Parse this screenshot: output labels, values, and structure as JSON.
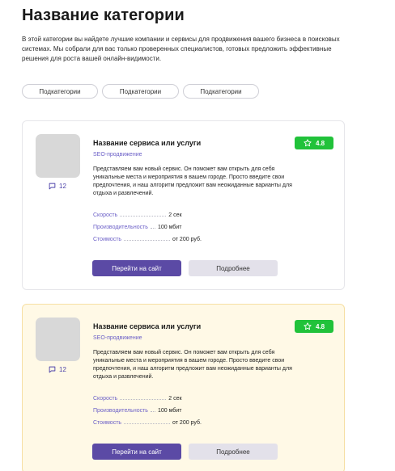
{
  "page": {
    "title": "Название категории",
    "description": "В этой категории вы найдете лучшие компании и сервисы для продвижения вашего бизнеса в поисковых системах. Мы собрали для вас только проверенных специалистов, готовых предложить эффективные решения для роста вашей онлайн-видимости."
  },
  "subcategories": [
    "Подкатегории",
    "Подкатегории",
    "Подкатегории"
  ],
  "colors": {
    "accent": "#5b4aa5",
    "rating": "#21c23a",
    "featured_bg": "#fff9e6",
    "link": "#6b5fc7"
  },
  "cards": [
    {
      "title": "Название сервиса или услуги",
      "category": "SEO-продвижение",
      "rating": "4.8",
      "comments": "12",
      "description": "Представляем вам новый сервис. Он поможет вам открыть для себя уникальные места и мероприятия в вашем городе. Просто введите свои предпочтения, и наш алгоритм предложит вам неожиданные варианты для отдыха и развлечений.",
      "specs": [
        {
          "label": "Скорость",
          "value": "2 сек"
        },
        {
          "label": "Производительность",
          "value": "100 мбит"
        },
        {
          "label": "Стоимость",
          "value": "от 200 руб."
        }
      ],
      "primary_button": "Перейти на сайт",
      "secondary_button": "Подробнее"
    },
    {
      "title": "Название сервиса или услуги",
      "category": "SEO-продвижение",
      "rating": "4.8",
      "comments": "12",
      "description": "Представляем вам новый сервис. Он поможет вам открыть для себя уникальные места и мероприятия в вашем городе. Просто введите свои предпочтения, и наш алгоритм предложит вам неожиданные варианты для отдыха и развлечений.",
      "specs": [
        {
          "label": "Скорость",
          "value": "2 сек"
        },
        {
          "label": "Производительность",
          "value": "100 мбит"
        },
        {
          "label": "Стоимость",
          "value": "от 200 руб."
        }
      ],
      "primary_button": "Перейти на сайт",
      "secondary_button": "Подробнее"
    }
  ],
  "icons": {
    "comment": "comment-icon",
    "star": "star-icon"
  }
}
